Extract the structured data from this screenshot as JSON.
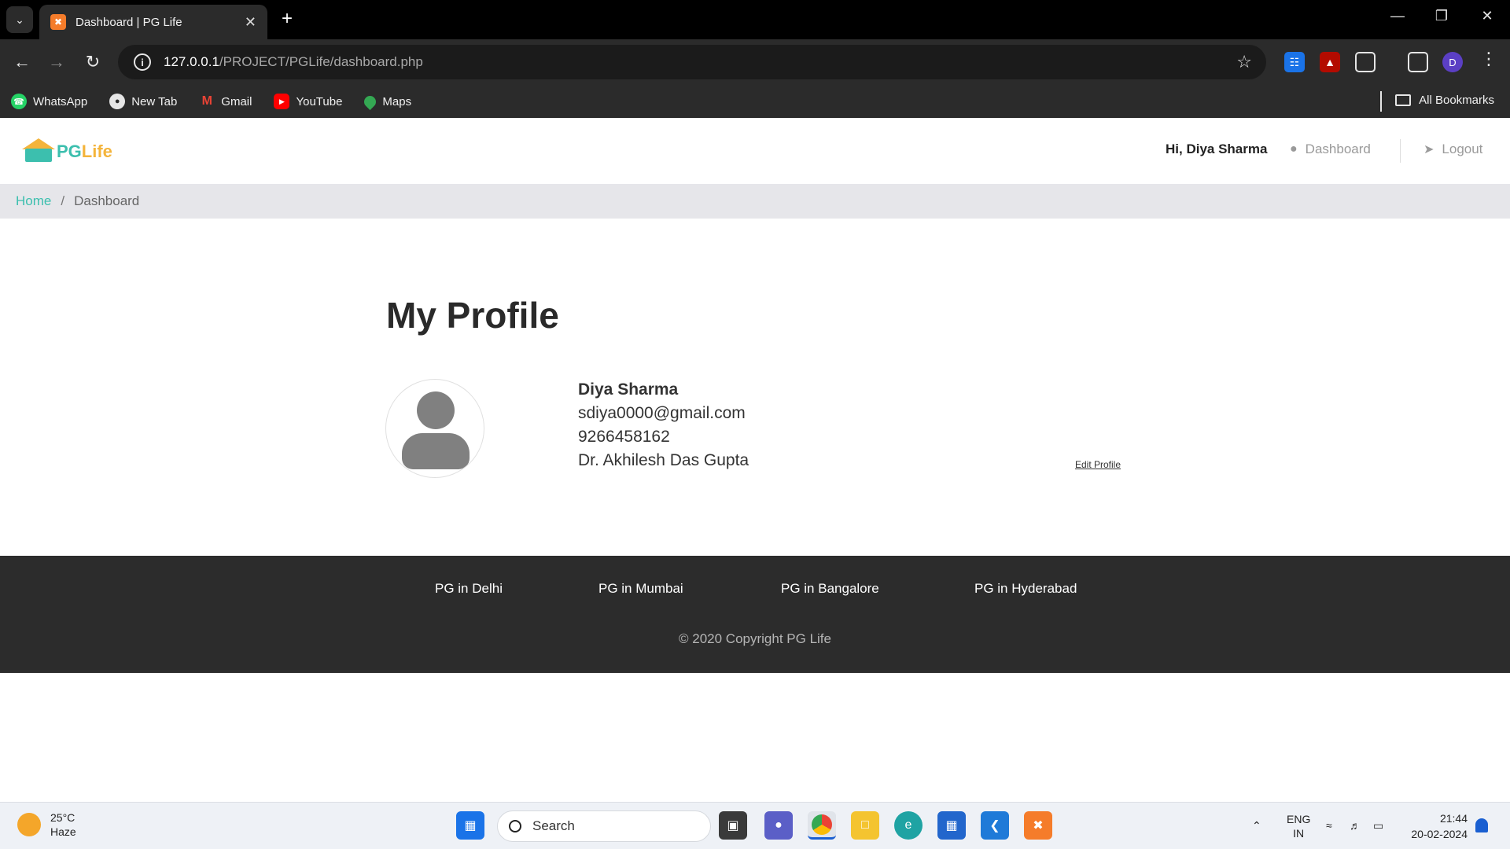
{
  "browser": {
    "tab_title": "Dashboard | PG Life",
    "url_host": "127.0.0.1",
    "url_path": "/PROJECT/PGLife/dashboard.php",
    "profile_initial": "D",
    "bookmarks": [
      {
        "label": "WhatsApp",
        "icon": "whatsapp-icon",
        "color": "#25d366"
      },
      {
        "label": "New Tab",
        "icon": "globe-icon",
        "color": "#e6e6e6"
      },
      {
        "label": "Gmail",
        "icon": "gmail-icon",
        "color": "#ea4335"
      },
      {
        "label": "YouTube",
        "icon": "youtube-icon",
        "color": "#ff0000"
      },
      {
        "label": "Maps",
        "icon": "maps-icon",
        "color": "#34a853"
      }
    ],
    "all_bookmarks": "All Bookmarks"
  },
  "header": {
    "logo_pg": "PG",
    "logo_life": "Life",
    "greeting": "Hi, Diya Sharma",
    "dashboard_link": "Dashboard",
    "logout_link": "Logout"
  },
  "breadcrumb": {
    "home": "Home",
    "separator": "/",
    "current": "Dashboard"
  },
  "profile": {
    "title": "My Profile",
    "name": "Diya Sharma",
    "email": "sdiya0000@gmail.com",
    "phone": "9266458162",
    "college": "Dr. Akhilesh Das Gupta",
    "edit_link": "Edit Profile"
  },
  "footer": {
    "links": [
      "PG in Delhi",
      "PG in Mumbai",
      "PG in Bangalore",
      "PG in Hyderabad"
    ],
    "copyright": "© 2020 Copyright PG Life"
  },
  "taskbar": {
    "temperature": "25°C",
    "condition": "Haze",
    "search_placeholder": "Search",
    "language": "ENG",
    "region": "IN",
    "time": "21:44",
    "date": "20-02-2024"
  },
  "colors": {
    "accent_teal": "#3cbfae",
    "accent_yellow": "#f4b43b",
    "footer_bg": "#2c2c2c",
    "breadcrumb_bg": "#e6e6ea"
  }
}
